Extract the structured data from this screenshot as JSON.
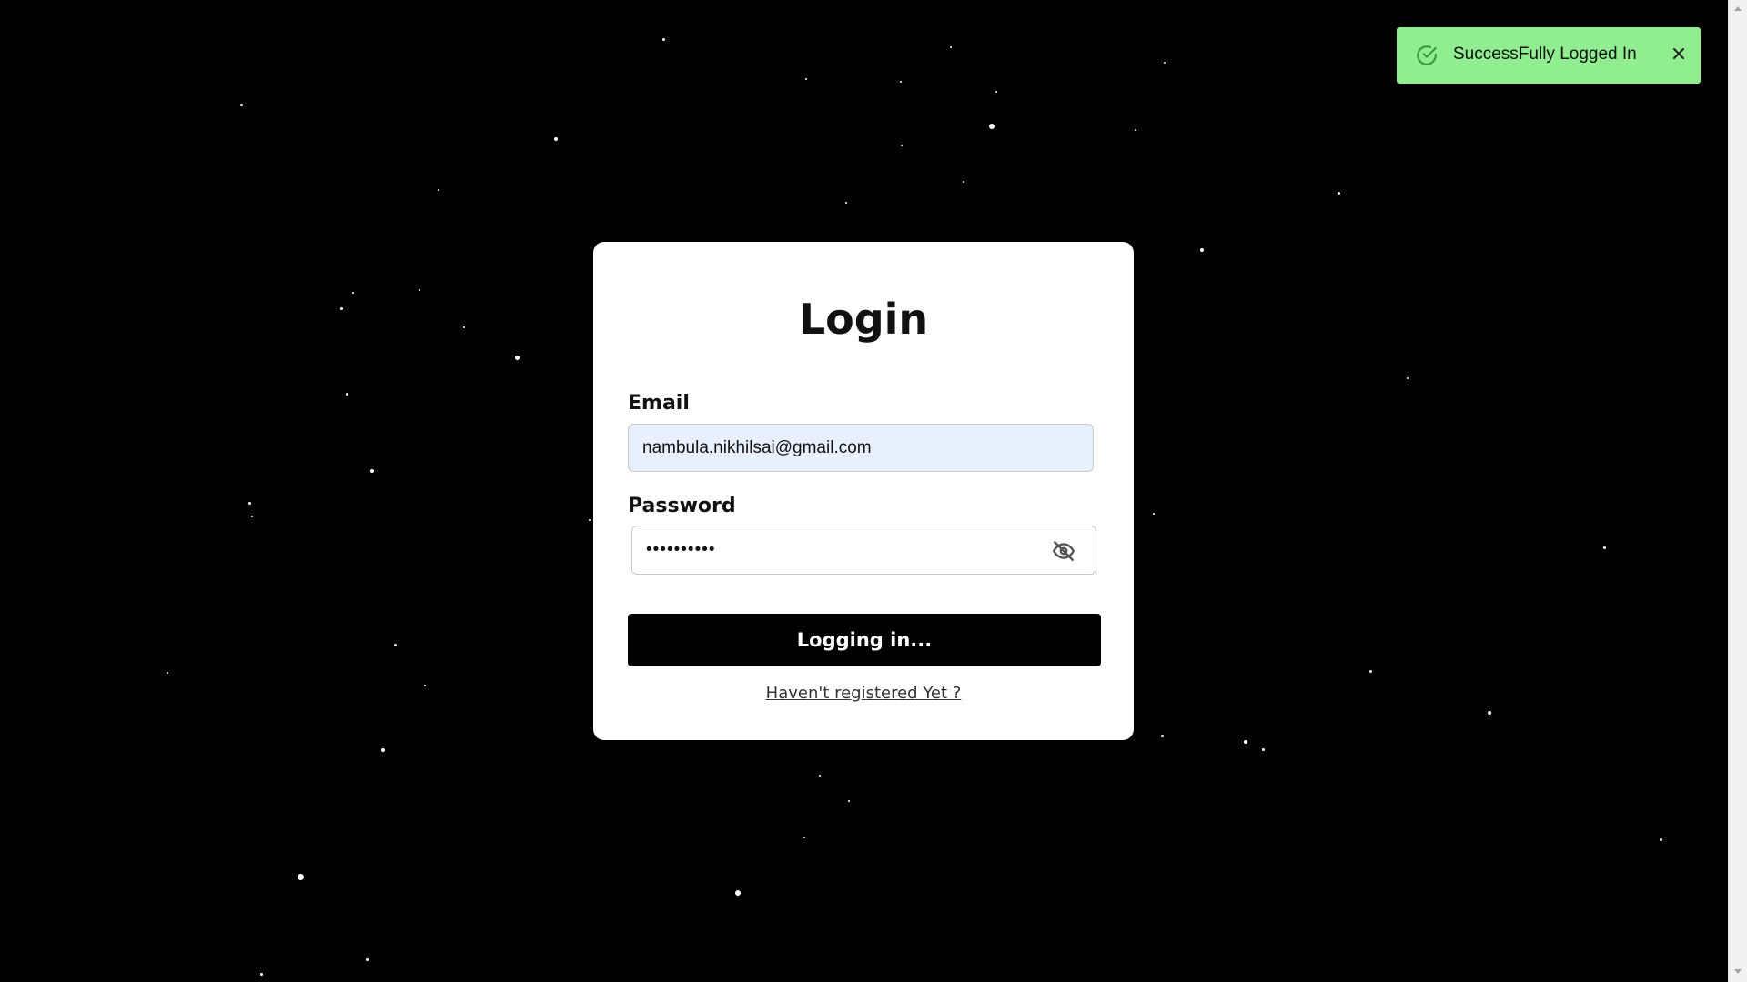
{
  "login": {
    "title": "Login",
    "email_label": "Email",
    "email_value": "nambula.nikhilsai@gmail.com",
    "password_label": "Password",
    "password_value": "••••••••••",
    "submit_label": "Logging in...",
    "register_link": "Haven't registered Yet ?"
  },
  "toast": {
    "message": "SuccessFully Logged In",
    "color": "#90ee90"
  },
  "icons": {
    "toast_status": "check-circle-icon",
    "toast_close": "close-icon",
    "password_toggle": "eye-off-icon"
  }
}
